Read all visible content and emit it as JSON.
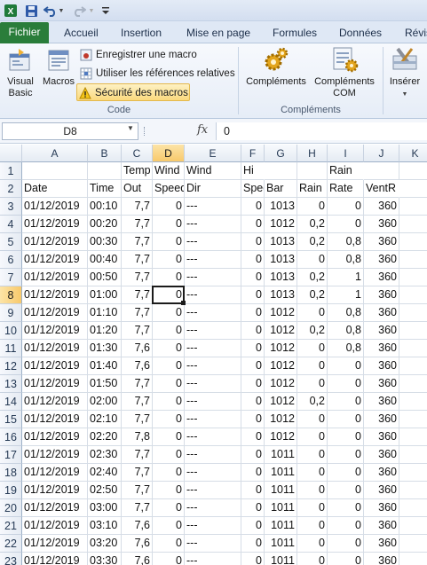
{
  "quick_access": {
    "icons": [
      "excel-icon",
      "save-icon",
      "undo-icon",
      "redo-icon",
      "customize-icon"
    ]
  },
  "tabs": [
    "Fichier",
    "Accueil",
    "Insertion",
    "Mise en page",
    "Formules",
    "Données",
    "Révis"
  ],
  "ribbon": {
    "code_group": {
      "label": "Code",
      "visual_basic": "Visual Basic",
      "macros": "Macros",
      "record_macro": "Enregistrer une macro",
      "relative_refs": "Utiliser les références relatives",
      "macro_security": "Sécurité des macros"
    },
    "addins_group": {
      "label": "Compléments",
      "addins": "Compléments",
      "com_addins": "Compléments COM"
    },
    "insert_label": "Insérer"
  },
  "formula_bar": {
    "name_box": "D8",
    "fx": "fx",
    "value": "0"
  },
  "grid": {
    "columns": [
      "A",
      "B",
      "C",
      "D",
      "E",
      "F",
      "G",
      "H",
      "I",
      "J",
      "K"
    ],
    "selected_column": "D",
    "selected_row": "8",
    "rows": [
      {
        "n": "1",
        "cells": [
          "",
          "",
          "Temp",
          "Wind",
          "Wind",
          "Hi",
          "",
          "",
          "Rain",
          "",
          ""
        ]
      },
      {
        "n": "2",
        "cells": [
          "Date",
          "Time",
          "Out",
          "Speed",
          "Dir",
          "Speed",
          "Bar",
          "Rain",
          "Rate",
          "VentR",
          ""
        ]
      },
      {
        "n": "3",
        "cells": [
          "01/12/2019",
          "00:10",
          "7,7",
          "0",
          "---",
          "0",
          "1013",
          "0",
          "0",
          "360",
          ""
        ]
      },
      {
        "n": "4",
        "cells": [
          "01/12/2019",
          "00:20",
          "7,7",
          "0",
          "---",
          "0",
          "1012",
          "0,2",
          "0",
          "360",
          ""
        ]
      },
      {
        "n": "5",
        "cells": [
          "01/12/2019",
          "00:30",
          "7,7",
          "0",
          "---",
          "0",
          "1013",
          "0,2",
          "0,8",
          "360",
          ""
        ]
      },
      {
        "n": "6",
        "cells": [
          "01/12/2019",
          "00:40",
          "7,7",
          "0",
          "---",
          "0",
          "1013",
          "0",
          "0,8",
          "360",
          ""
        ]
      },
      {
        "n": "7",
        "cells": [
          "01/12/2019",
          "00:50",
          "7,7",
          "0",
          "---",
          "0",
          "1013",
          "0,2",
          "1",
          "360",
          ""
        ]
      },
      {
        "n": "8",
        "cells": [
          "01/12/2019",
          "01:00",
          "7,7",
          "0",
          "---",
          "0",
          "1013",
          "0,2",
          "1",
          "360",
          ""
        ]
      },
      {
        "n": "9",
        "cells": [
          "01/12/2019",
          "01:10",
          "7,7",
          "0",
          "---",
          "0",
          "1012",
          "0",
          "0,8",
          "360",
          ""
        ]
      },
      {
        "n": "10",
        "cells": [
          "01/12/2019",
          "01:20",
          "7,7",
          "0",
          "---",
          "0",
          "1012",
          "0,2",
          "0,8",
          "360",
          ""
        ]
      },
      {
        "n": "11",
        "cells": [
          "01/12/2019",
          "01:30",
          "7,6",
          "0",
          "---",
          "0",
          "1012",
          "0",
          "0,8",
          "360",
          ""
        ]
      },
      {
        "n": "12",
        "cells": [
          "01/12/2019",
          "01:40",
          "7,6",
          "0",
          "---",
          "0",
          "1012",
          "0",
          "0",
          "360",
          ""
        ]
      },
      {
        "n": "13",
        "cells": [
          "01/12/2019",
          "01:50",
          "7,7",
          "0",
          "---",
          "0",
          "1012",
          "0",
          "0",
          "360",
          ""
        ]
      },
      {
        "n": "14",
        "cells": [
          "01/12/2019",
          "02:00",
          "7,7",
          "0",
          "---",
          "0",
          "1012",
          "0,2",
          "0",
          "360",
          ""
        ]
      },
      {
        "n": "15",
        "cells": [
          "01/12/2019",
          "02:10",
          "7,7",
          "0",
          "---",
          "0",
          "1012",
          "0",
          "0",
          "360",
          ""
        ]
      },
      {
        "n": "16",
        "cells": [
          "01/12/2019",
          "02:20",
          "7,8",
          "0",
          "---",
          "0",
          "1012",
          "0",
          "0",
          "360",
          ""
        ]
      },
      {
        "n": "17",
        "cells": [
          "01/12/2019",
          "02:30",
          "7,7",
          "0",
          "---",
          "0",
          "1011",
          "0",
          "0",
          "360",
          ""
        ]
      },
      {
        "n": "18",
        "cells": [
          "01/12/2019",
          "02:40",
          "7,7",
          "0",
          "---",
          "0",
          "1011",
          "0",
          "0",
          "360",
          ""
        ]
      },
      {
        "n": "19",
        "cells": [
          "01/12/2019",
          "02:50",
          "7,7",
          "0",
          "---",
          "0",
          "1011",
          "0",
          "0",
          "360",
          ""
        ]
      },
      {
        "n": "20",
        "cells": [
          "01/12/2019",
          "03:00",
          "7,7",
          "0",
          "---",
          "0",
          "1011",
          "0",
          "0",
          "360",
          ""
        ]
      },
      {
        "n": "21",
        "cells": [
          "01/12/2019",
          "03:10",
          "7,6",
          "0",
          "---",
          "0",
          "1011",
          "0",
          "0",
          "360",
          ""
        ]
      },
      {
        "n": "22",
        "cells": [
          "01/12/2019",
          "03:20",
          "7,6",
          "0",
          "---",
          "0",
          "1011",
          "0",
          "0",
          "360",
          ""
        ]
      },
      {
        "n": "23",
        "cells": [
          "01/12/2019",
          "03:30",
          "7,6",
          "0",
          "---",
          "0",
          "1011",
          "0",
          "0",
          "360",
          ""
        ]
      }
    ]
  }
}
